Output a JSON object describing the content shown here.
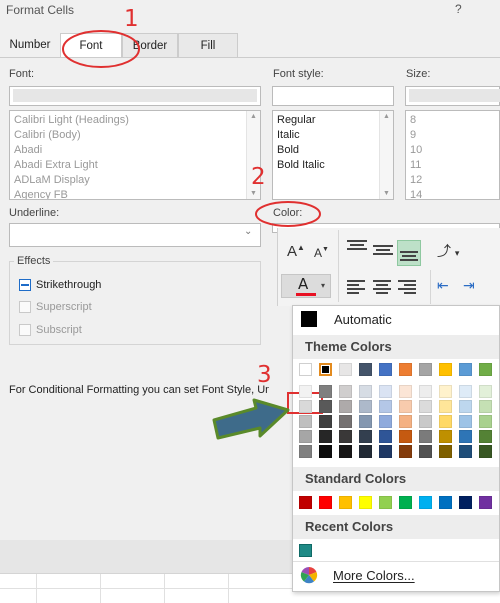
{
  "dialog": {
    "title": "Format Cells",
    "help": "?"
  },
  "tabs": [
    {
      "label": "Number"
    },
    {
      "label": "Font"
    },
    {
      "label": "Border"
    },
    {
      "label": "Fill"
    }
  ],
  "font": {
    "label": "Font:",
    "items": [
      "Calibri Light (Headings)",
      "Calibri (Body)",
      "Abadi",
      "Abadi Extra Light",
      "ADLaM Display",
      "Agency FB"
    ]
  },
  "font_style": {
    "label": "Font style:",
    "items": [
      "Regular",
      "Italic",
      "Bold",
      "Bold Italic"
    ]
  },
  "size": {
    "label": "Size:",
    "items": [
      "8",
      "9",
      "10",
      "11",
      "12",
      "14"
    ]
  },
  "underline": {
    "label": "Underline:"
  },
  "color": {
    "label": "Color:"
  },
  "effects": {
    "title": "Effects",
    "strikethrough": {
      "label": "Strikethrough",
      "state": "indeterminate"
    },
    "superscript": {
      "label": "Superscript",
      "enabled": false
    },
    "subscript": {
      "label": "Subscript",
      "enabled": false
    }
  },
  "note": "For Conditional Formatting you can set Font Style, Un",
  "ribbon": {
    "icons": [
      "grow-font-icon",
      "shrink-font-icon",
      "align-top-icon",
      "align-middle-icon",
      "align-bottom-icon",
      "orientation-icon",
      "font-color-icon",
      "align-left-icon",
      "align-center-icon",
      "align-right-icon",
      "decrease-indent-icon",
      "increase-indent-icon"
    ],
    "grow_glyph": "A",
    "shrink_glyph": "A",
    "font_color_glyph": "A",
    "font_color_bar": "#e81123",
    "decrease_indent_glyph": "⇤",
    "increase_indent_glyph": "⇥",
    "orientation_glyph": "⤴",
    "caret": "▾"
  },
  "palette": {
    "automatic_label": "Automatic",
    "theme_header": "Theme Colors",
    "standard_header": "Standard Colors",
    "recent_header": "Recent Colors",
    "more_colors_label": "More Colors...",
    "theme_columns": [
      [
        "#ffffff",
        "#f2f2f2",
        "#d9d9d9",
        "#bfbfbf",
        "#a6a6a6",
        "#808080"
      ],
      [
        "#000000",
        "#7f7f7f",
        "#595959",
        "#404040",
        "#262626",
        "#0d0d0d"
      ],
      [
        "#e7e6e6",
        "#d0cece",
        "#aeaaaa",
        "#757171",
        "#3a3838",
        "#171616"
      ],
      [
        "#44546a",
        "#d6dce4",
        "#adb9ca",
        "#8497b0",
        "#333f4f",
        "#222a35"
      ],
      [
        "#4472c4",
        "#dae3f3",
        "#b4c7e7",
        "#8faadc",
        "#2f5597",
        "#1f3864"
      ],
      [
        "#ed7d31",
        "#fbe5d6",
        "#f8cbad",
        "#f4b183",
        "#c55a11",
        "#843c0c"
      ],
      [
        "#a5a5a5",
        "#ededed",
        "#dbdbdb",
        "#c9c9c9",
        "#7b7b7b",
        "#525252"
      ],
      [
        "#ffc000",
        "#fff2cc",
        "#ffe699",
        "#ffd966",
        "#bf9000",
        "#7f6000"
      ],
      [
        "#5b9bd5",
        "#deebf7",
        "#bdd7ee",
        "#9dc3e6",
        "#2e75b6",
        "#1f4e79"
      ],
      [
        "#70ad47",
        "#e2f0d9",
        "#c5e0b4",
        "#a9d18e",
        "#548235",
        "#385723"
      ]
    ],
    "selected_theme": [
      1,
      0
    ],
    "standard": [
      "#c00000",
      "#ff0000",
      "#ffc000",
      "#ffff00",
      "#92d050",
      "#00b050",
      "#00b0f0",
      "#0070c0",
      "#002060",
      "#7030a0"
    ],
    "recent": [
      "#1f8a86"
    ]
  },
  "annotations": {
    "n1": "1",
    "n2": "2",
    "n3": "3"
  }
}
